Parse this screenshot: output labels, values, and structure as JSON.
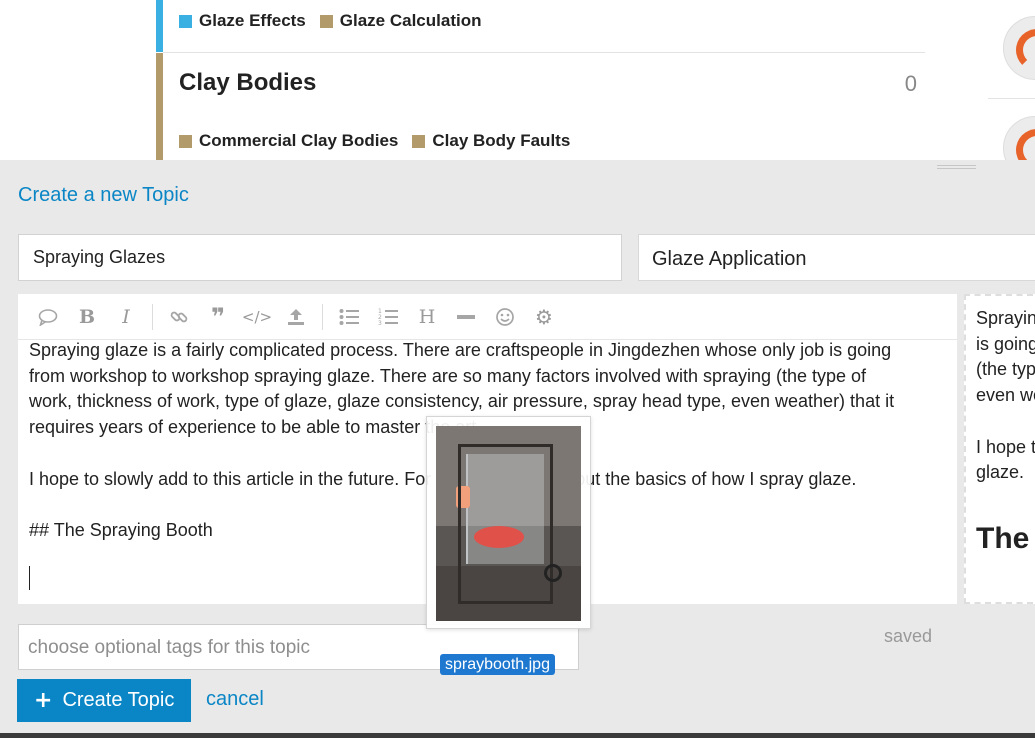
{
  "categories": {
    "row1": {
      "subcategories": [
        {
          "label": "Glaze Effects",
          "color": "#3ab0e2"
        },
        {
          "label": "Glaze Calculation",
          "color": "#b29a6a"
        }
      ]
    },
    "row2": {
      "title": "Clay Bodies",
      "count": "0",
      "subcategories": [
        {
          "label": "Commercial Clay Bodies",
          "color": "#b29a6a"
        },
        {
          "label": "Clay Body Faults",
          "color": "#b29a6a"
        }
      ]
    }
  },
  "composer": {
    "heading": "Create a new Topic",
    "title_value": "Spraying Glazes",
    "category_value": "Glaze Application",
    "toolbar_icons": [
      "quote-icon",
      "bold-icon",
      "italic-icon",
      "link-icon",
      "blockquote-icon",
      "code-icon",
      "upload-icon",
      "bullet-list-icon",
      "numbered-list-icon",
      "heading-icon",
      "horizontal-rule-icon",
      "emoji-icon",
      "gear-icon"
    ],
    "body_text": "Spraying glaze is a fairly complicated process. There are craftspeople in Jingdezhen whose only job is going\nfrom workshop to workshop spraying glaze. There are so many factors involved with spraying (the type of\nwork, thickness of work, type of glaze, glaze consistency, air pressure, spray head type, even weather) that it\nrequires years of experience to be able to master the art.\n\nI hope to slowly add to this article in the future. For now I will just lay out the basics of how I spray glaze.\n\n## The Spraying Booth",
    "preview_text": "Spraying glaze is a fairly complicated process.\nis going from workshop to workshop spraying glaze.\n(the type of work, thickness of work, type of glaze,\neven weather) that it requires years of experience.\n\nI hope to slowly add to this article in the future.\nglaze.",
    "preview_heading": "The Spraying Booth",
    "tags_placeholder": "choose optional tags for this topic",
    "status": "saved",
    "create_label": "Create Topic",
    "cancel_label": "cancel"
  },
  "drag_ghost": {
    "filename": "spraybooth.jpg"
  },
  "colors": {
    "accent": "#0a86c6",
    "composer_bg": "#e9e9e9"
  }
}
